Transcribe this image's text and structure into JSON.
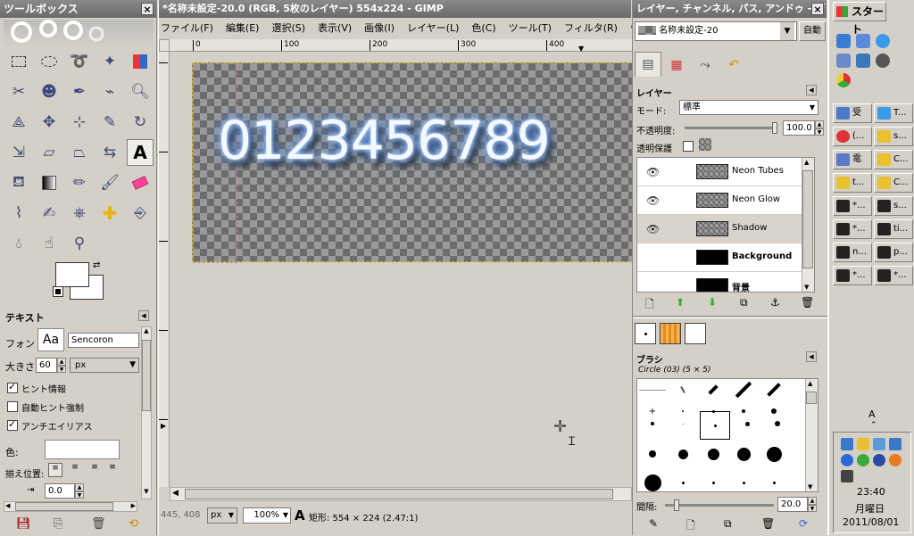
{
  "toolbox": {
    "title": "ツールボックス",
    "tools": [
      "rect-select",
      "ellipse-select",
      "free-select",
      "fuzzy-select",
      "select-by-color",
      "scissors",
      "foreground-select",
      "paths",
      "color-picker",
      "zoom",
      "measure",
      "move",
      "align",
      "crop",
      "rotate",
      "scale",
      "shear",
      "perspective",
      "flip",
      "text",
      "bucket-fill",
      "blend",
      "pencil",
      "paintbrush",
      "eraser",
      "airbrush",
      "ink",
      "clone",
      "heal",
      "perspective-clone",
      "blur",
      "smudge",
      "dodge-burn"
    ],
    "text_options": {
      "title": "テキスト",
      "font_label": "フォント:",
      "font_preview": "Aa",
      "font_value": "Sencoron",
      "size_label": "大きさ",
      "size_value": "60",
      "unit_value": "px",
      "hinting_label": "ヒント情報",
      "autohint_label": "自動ヒント強制",
      "antialias_label": "アンチエイリアス",
      "color_label": "色:",
      "justify_label": "揃え位置:",
      "indent_value": "0.0"
    }
  },
  "image_window": {
    "title": "*名称未設定-20.0 (RGB, 5枚のレイヤー) 554x224 - GIMP",
    "menu": [
      "ファイル(F)",
      "編集(E)",
      "選択(S)",
      "表示(V)",
      "画像(I)",
      "レイヤー(L)",
      "色(C)",
      "ツール(T)",
      "フィルタ(R)",
      "ウィン"
    ],
    "ruler_ticks": [
      "0",
      "100",
      "200",
      "300",
      "400"
    ],
    "neon_text": "0123456789",
    "status": {
      "coords": "445, 408",
      "unit": "px",
      "zoom": "100%",
      "info": "矩形: 554 × 224 (2.47:1)"
    }
  },
  "layers_dock": {
    "title": "レイヤー, チャンネル, パス, アンドゥ - ブ",
    "image_select": "名称未設定-20",
    "auto_button": "自動",
    "panel_title": "レイヤー",
    "mode_label": "モード:",
    "mode_value": "標準",
    "opacity_label": "不透明度:",
    "opacity_value": "100.0",
    "lock_label": "透明保護",
    "layers": [
      {
        "name": "Neon Tubes",
        "visible": true,
        "bold": false
      },
      {
        "name": "Neon Glow",
        "visible": true,
        "bold": false
      },
      {
        "name": "Shadow",
        "visible": true,
        "bold": false
      },
      {
        "name": "Background",
        "visible": false,
        "bold": true
      },
      {
        "name": "背景",
        "visible": false,
        "bold": true
      }
    ],
    "brushes_title": "ブラシ",
    "brush_name": "Circle (03) (5 × 5)",
    "spacing_label": "間隔:",
    "spacing_value": "20.0"
  },
  "taskbar": {
    "start_label": "スタート",
    "buttons": [
      "受",
      "T...",
      "(...",
      "s...",
      "電",
      "C...",
      "t...",
      "C...",
      "*...",
      "s...",
      "*...",
      "ti...",
      "n...",
      "p...",
      "*...",
      "*..."
    ],
    "ime_label": "A",
    "time": "23:40",
    "weekday": "月曜日",
    "date": "2011/08/01"
  }
}
